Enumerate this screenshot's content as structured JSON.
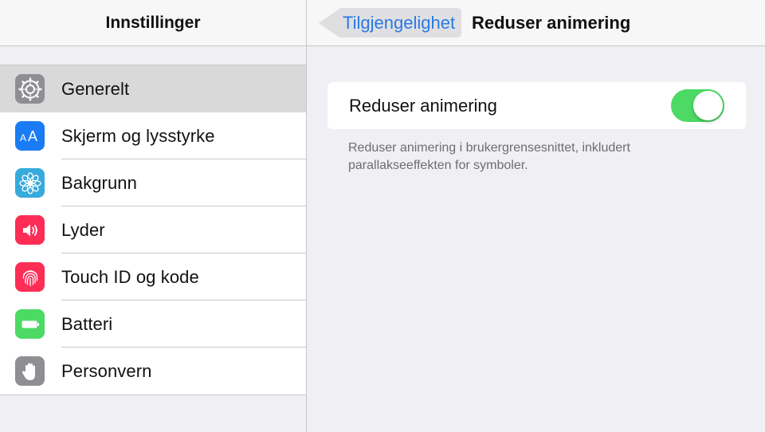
{
  "sidebar": {
    "title": "Innstillinger",
    "items": [
      {
        "label": "Generelt",
        "icon": "gear-icon",
        "color": "#8e8e93",
        "selected": true
      },
      {
        "label": "Skjerm og lysstyrke",
        "icon": "text-size-icon",
        "color": "#1a7cf4",
        "selected": false
      },
      {
        "label": "Bakgrunn",
        "icon": "flower-icon",
        "color": "#37aadc",
        "selected": false
      },
      {
        "label": "Lyder",
        "icon": "speaker-icon",
        "color": "#fe2d55",
        "selected": false
      },
      {
        "label": "Touch ID og kode",
        "icon": "fingerprint-icon",
        "color": "#fe2d55",
        "selected": false
      },
      {
        "label": "Batteri",
        "icon": "battery-icon",
        "color": "#4cd964",
        "selected": false
      },
      {
        "label": "Personvern",
        "icon": "hand-icon",
        "color": "#8e8e93",
        "selected": false
      }
    ],
    "icon_glyph_text": "AA"
  },
  "detail": {
    "back_label": "Tilgjengelighet",
    "title": "Reduser animering",
    "setting": {
      "label": "Reduser animering",
      "on": true,
      "toggle_color": "#4cd964"
    },
    "footer": "Reduser animering i brukergrensesnittet, inkludert parallakseeffekten for symboler."
  },
  "colors": {
    "accent": "#2a7ae2",
    "background": "#efeff4"
  }
}
